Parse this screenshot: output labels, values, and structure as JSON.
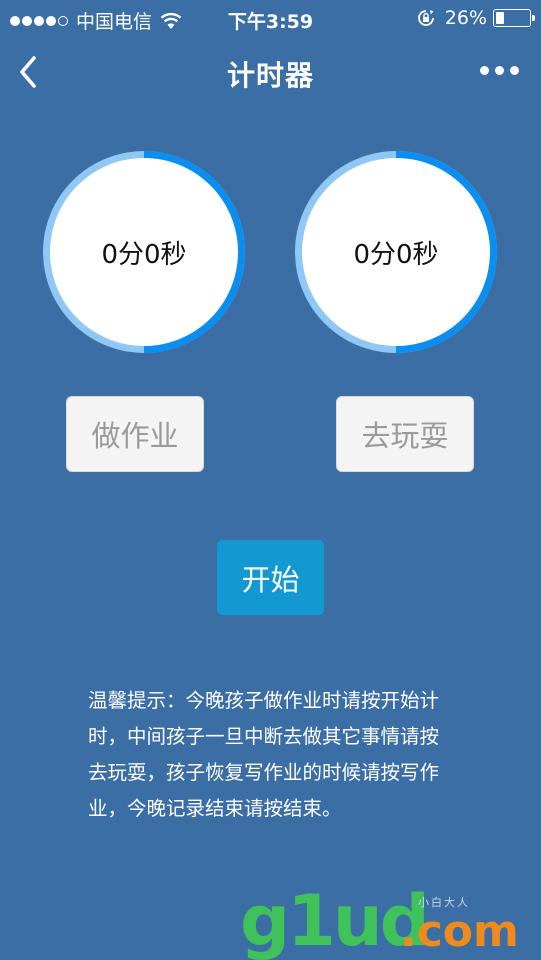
{
  "status_bar": {
    "carrier": "中国电信",
    "time": "下午3:59",
    "battery": "26%",
    "battery_level": 0.26,
    "signal_bars_filled": 4,
    "signal_bars_total": 5
  },
  "nav": {
    "title": "计时器",
    "back_icon": "chevron-left-icon",
    "more_icon": "more-dots-icon"
  },
  "timers": [
    {
      "id": "homework",
      "text": "0分0秒"
    },
    {
      "id": "play",
      "text": "0分0秒"
    }
  ],
  "buttons": {
    "homework_label": "做作业",
    "play_label": "去玩耍",
    "start_label": "开始"
  },
  "tip": {
    "text": "温馨提示：今晚孩子做作业时请按开始计时，中间孩子一旦中断去做其它事情请按去玩耍，孩子恢复写作业的时候请按写作业，今晚记录结束请按结束。"
  },
  "watermark": {
    "main": "g1ud",
    "suffix": ".com",
    "small": "小白大人"
  },
  "colors": {
    "background": "#3a6ea5",
    "ring_light": "#8fc7f5",
    "ring_dark": "#0a8ef0",
    "start_button": "#1399d1",
    "mode_button_bg": "#f4f4f4",
    "mode_button_text": "#9a9a9a"
  }
}
